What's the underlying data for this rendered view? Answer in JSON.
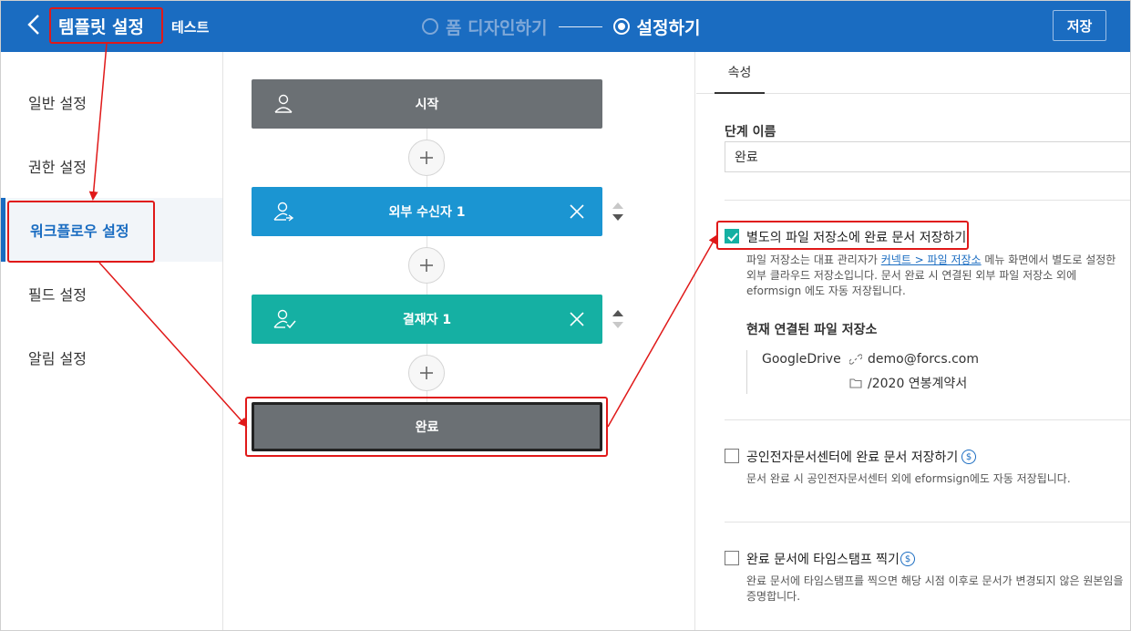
{
  "header": {
    "title": "템플릿 설정",
    "subtitle": "테스트",
    "steps": [
      {
        "label": "폼 디자인하기"
      },
      {
        "label": "설정하기"
      }
    ],
    "save_label": "저장"
  },
  "sidebar": {
    "items": [
      {
        "label": "일반 설정"
      },
      {
        "label": "권한 설정"
      },
      {
        "label": "워크플로우 설정"
      },
      {
        "label": "필드 설정"
      },
      {
        "label": "알림 설정"
      }
    ]
  },
  "workflow": {
    "nodes": [
      {
        "label": "시작"
      },
      {
        "label": "외부 수신자 1"
      },
      {
        "label": "결재자 1"
      },
      {
        "label": "완료"
      }
    ]
  },
  "panel": {
    "tab": "속성",
    "step_name_label": "단계 이름",
    "step_name_value": "완료",
    "opt1": {
      "label": "별도의 파일 저장소에 완료 문서 저장하기",
      "checked": true,
      "desc_before": "파일 저장소는 대표 관리자가 ",
      "desc_link": "커넥트 > 파일 저장소",
      "desc_after": " 메뉴 화면에서 별도로 설정한 외부 클라우드 저장소입니다. 문서 완료 시 연결된 외부 파일 저장소 외에 eformsign 에도 자동 저장됩니다.",
      "connected_title": "현재 연결된 파일 저장소",
      "storage_name": "GoogleDrive",
      "storage_account": "demo@forcs.com",
      "storage_folder": "/2020 연봉계약서"
    },
    "opt2": {
      "label": "공인전자문서센터에 완료 문서 저장하기",
      "checked": false,
      "desc": "문서 완료 시 공인전자문서센터 외에 eformsign에도 자동 저장됩니다."
    },
    "opt3": {
      "label": "완료 문서에 타임스탬프 찍기",
      "checked": false,
      "desc": "완료 문서에 타임스탬프를 찍으면 해당 시점 이후로 문서가 변경되지 않은 원본임을 증명합니다."
    },
    "paid_symbol": "$"
  },
  "colors": {
    "header": "#1a6cc1",
    "start_node": "#6b7074",
    "external_node": "#1b95d2",
    "approver_node": "#15b0a3",
    "annotation": "#e01919"
  }
}
